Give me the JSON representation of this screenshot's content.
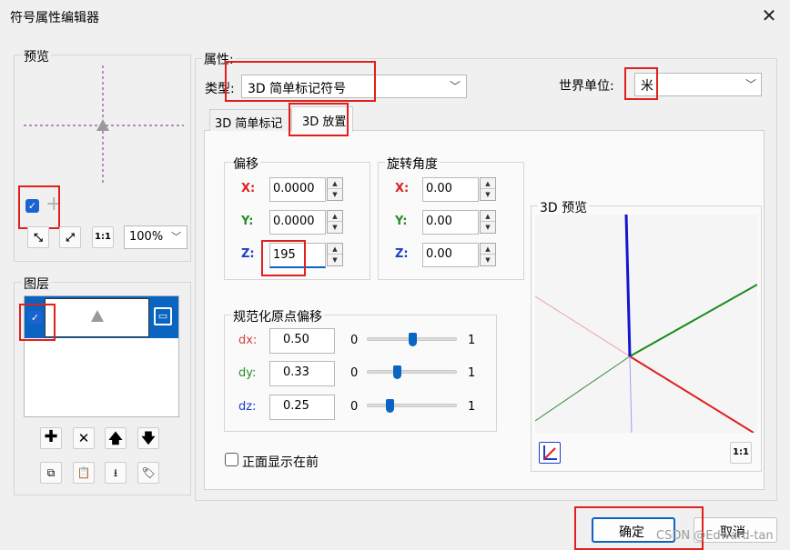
{
  "window": {
    "title": "符号属性编辑器",
    "close_glyph": "✕"
  },
  "preview_panel": {
    "title": "预览",
    "check_glyph": "✓",
    "plus_glyph": "+",
    "zoom_value": "100%"
  },
  "layers_panel": {
    "title": "图层",
    "check_glyph": "✓"
  },
  "properties": {
    "title": "属性:",
    "type_label": "类型:",
    "type_value": "3D 简单标记符号",
    "world_unit_label": "世界单位:",
    "world_unit_value": "米"
  },
  "tabs": [
    {
      "label": "3D 简单标记"
    },
    {
      "label": "3D 放置"
    }
  ],
  "offset_group": {
    "title": "偏移",
    "x_label": "X:",
    "x_value": "0.0000",
    "y_label": "Y:",
    "y_value": "0.0000",
    "z_label": "Z:",
    "z_value": "195"
  },
  "rotation_group": {
    "title": "旋转角度",
    "x_label": "X:",
    "x_value": "0.00",
    "y_label": "Y:",
    "y_value": "0.00",
    "z_label": "Z:",
    "z_value": "0.00"
  },
  "origin_group": {
    "title": "规范化原点偏移",
    "dx_label": "dx:",
    "dx_value": "0.50",
    "dx_level": 0.5,
    "dy_label": "dy:",
    "dy_value": "0.33",
    "dy_level": 0.33,
    "dz_label": "dz:",
    "dz_value": "0.25",
    "dz_level": 0.25,
    "min_label": "0",
    "max_label": "1"
  },
  "preview3d": {
    "title": "3D 预览",
    "reset_label": "1:1"
  },
  "front_checkbox_label": "正面显示在前",
  "buttons": {
    "ok": "确定",
    "cancel": "取消"
  },
  "watermark": "CSDN @Edward-tan",
  "colors": {
    "accent": "#0a65c2",
    "highlight": "#e0201c"
  }
}
